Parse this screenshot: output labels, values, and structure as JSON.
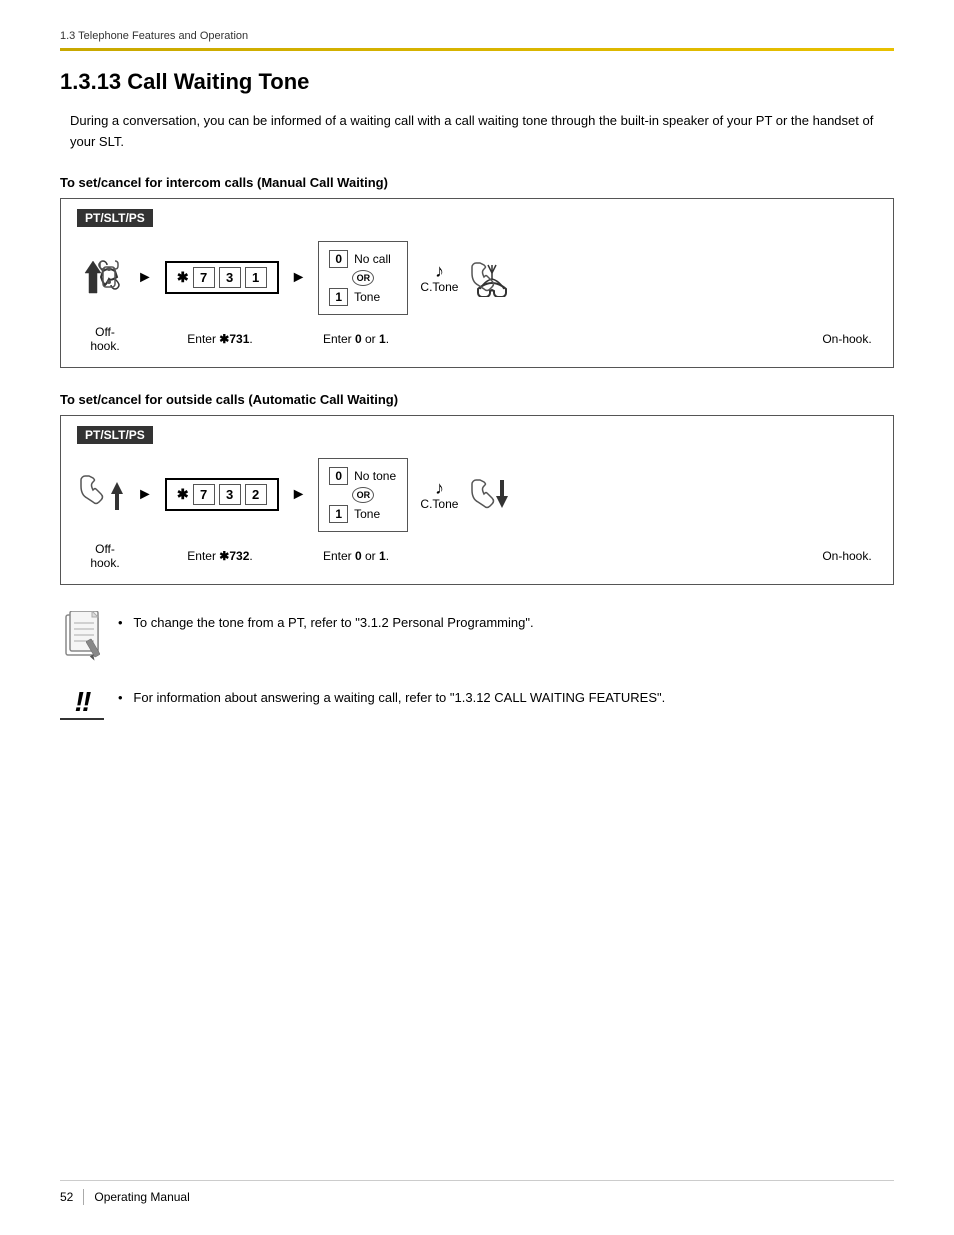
{
  "breadcrumb": "1.3 Telephone Features and Operation",
  "page_title": "1.3.13   Call Waiting Tone",
  "intro_text": "During a conversation, you can be informed of a waiting call with a call waiting tone through the built-in speaker of your PT or the handset of your SLT.",
  "section1": {
    "heading": "To set/cancel for intercom calls (Manual Call Waiting)",
    "pt_label": "PT/SLT/PS",
    "key_sequence": [
      "✱",
      "7",
      "3",
      "1"
    ],
    "options": {
      "key0": "0",
      "label0": "No call",
      "or_text": "OR",
      "key1": "1",
      "label1": "Tone"
    },
    "ctone_label": "C.Tone",
    "labels": {
      "offhook": "Off-hook.",
      "enter_key": "Enter ",
      "key_code": "✱731",
      "enter_01": "Enter ",
      "zero": "0",
      "or_text": " or ",
      "one": "1",
      "period": ".",
      "onhook": "On-hook."
    }
  },
  "section2": {
    "heading": "To set/cancel for outside calls (Automatic Call Waiting)",
    "pt_label": "PT/SLT/PS",
    "key_sequence": [
      "✱",
      "7",
      "3",
      "2"
    ],
    "options": {
      "key0": "0",
      "label0": "No tone",
      "or_text": "OR",
      "key1": "1",
      "label1": "Tone"
    },
    "ctone_label": "C.Tone",
    "labels": {
      "offhook": "Off-hook.",
      "enter_key": "Enter ",
      "key_code": "✱732",
      "enter_01": "Enter ",
      "zero": "0",
      "or_text": " or ",
      "one": "1",
      "period": ".",
      "onhook": "On-hook."
    }
  },
  "note1": {
    "bullet": "•",
    "text": "To change the tone from a PT, refer to \"3.1.2 Personal Programming\"."
  },
  "note2": {
    "bullet": "•",
    "text": "For information about answering a waiting call, refer to \"1.3.12 CALL WAITING FEATURES\"."
  },
  "footer": {
    "page_number": "52",
    "manual_title": "Operating Manual"
  }
}
